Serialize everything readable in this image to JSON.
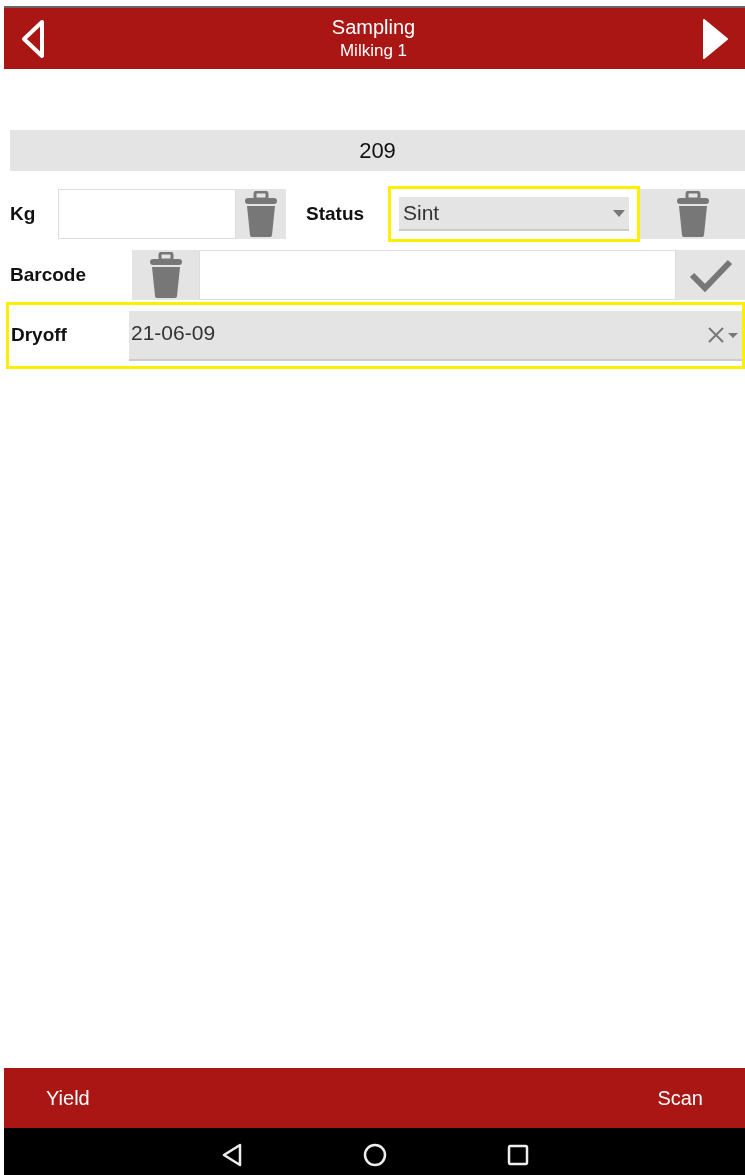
{
  "header": {
    "title": "Sampling",
    "subtitle": "Milking 1"
  },
  "animal_number": "209",
  "kg": {
    "label": "Kg"
  },
  "status": {
    "label": "Status",
    "value": "Sint",
    "highlighted": true
  },
  "barcode": {
    "label": "Barcode"
  },
  "dryoff": {
    "label": "Dryoff",
    "value": "21-06-09",
    "highlighted": true
  },
  "bottom_bar": [
    "Yield",
    "Scan"
  ]
}
